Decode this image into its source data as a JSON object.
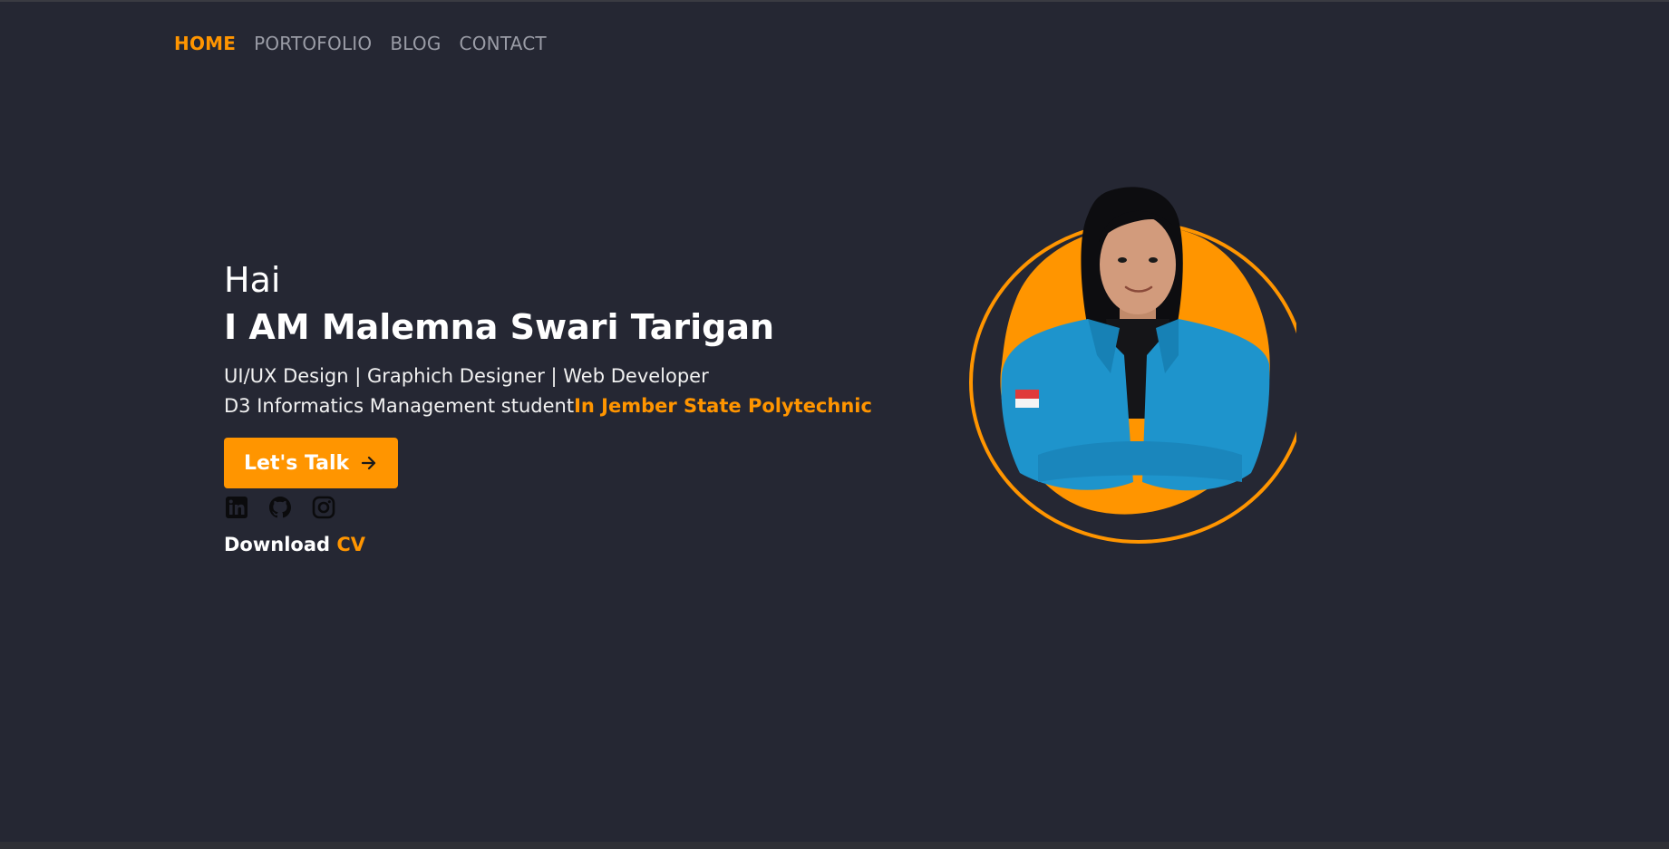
{
  "nav": {
    "items": [
      {
        "label": "HOME",
        "active": true
      },
      {
        "label": "PORTOFOLIO",
        "active": false
      },
      {
        "label": "BLOG",
        "active": false
      },
      {
        "label": "CONTACT",
        "active": false
      }
    ]
  },
  "hero": {
    "greeting": "Hai",
    "name": "I AM Malemna Swari Tarigan",
    "roles": "UI/UX Design | Graphich Designer | Web Developer",
    "study_prefix": "D3 Informatics Management student",
    "study_highlight": "In Jember State Polytechnic",
    "cta_label": "Let's Talk",
    "download_prefix": "Download",
    "download_highlight": "CV"
  },
  "socials": [
    {
      "icon": "linkedin-icon"
    },
    {
      "icon": "github-icon"
    },
    {
      "icon": "instagram-icon"
    }
  ],
  "colors": {
    "background": "#252733",
    "accent": "#ff9500",
    "nav_inactive": "#9a9ca6",
    "text": "#ffffff"
  }
}
